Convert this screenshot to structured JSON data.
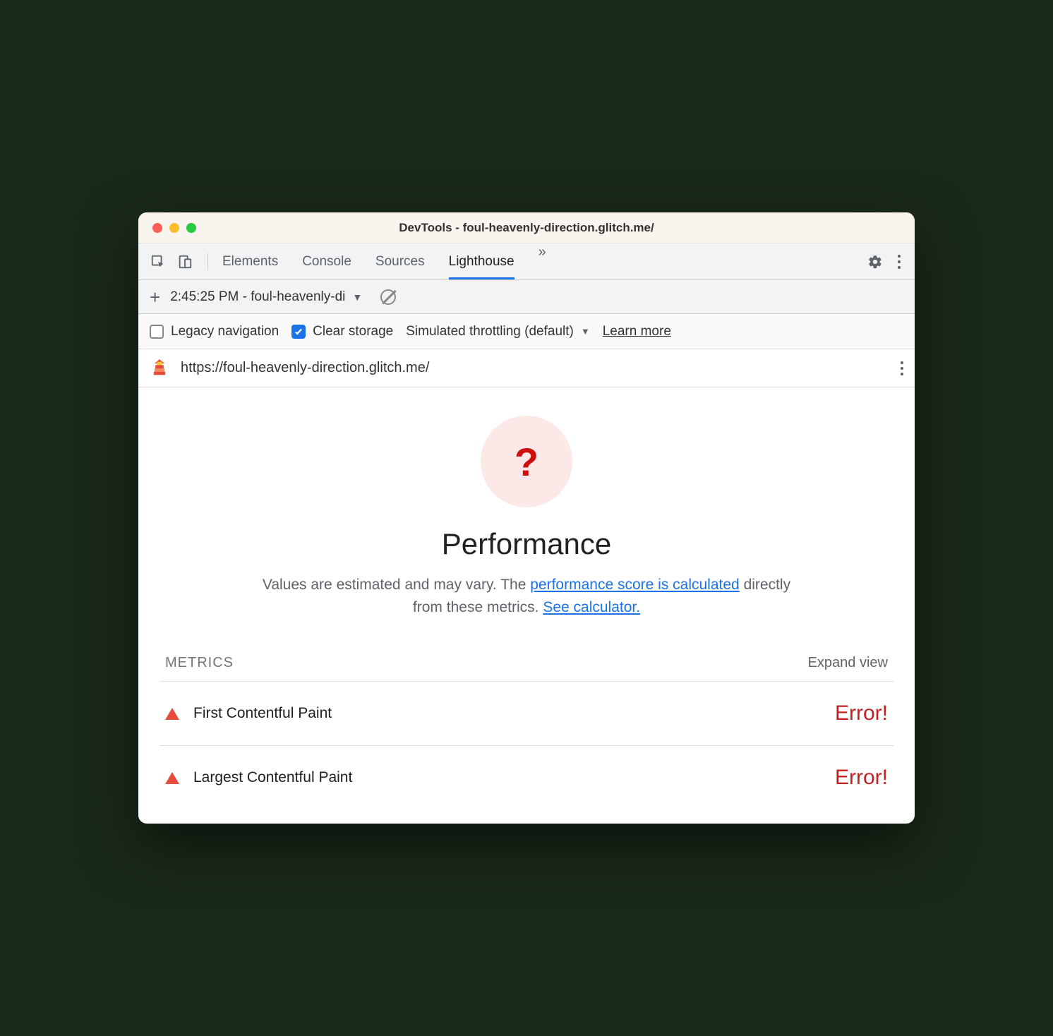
{
  "window": {
    "title": "DevTools - foul-heavenly-direction.glitch.me/"
  },
  "tabs": {
    "items": [
      "Elements",
      "Console",
      "Sources",
      "Lighthouse"
    ],
    "active": "Lighthouse"
  },
  "report_select": "2:45:25 PM - foul-heavenly-di",
  "options": {
    "legacy_nav": {
      "label": "Legacy navigation",
      "checked": false
    },
    "clear_storage": {
      "label": "Clear storage",
      "checked": true
    },
    "throttling": "Simulated throttling (default)",
    "learn_more": "Learn more"
  },
  "url": "https://foul-heavenly-direction.glitch.me/",
  "gauge_symbol": "?",
  "category_title": "Performance",
  "description": {
    "part1": "Values are estimated and may vary. The ",
    "link1": "performance score is calculated",
    "part2": " directly from these metrics. ",
    "link2": "See calculator."
  },
  "metrics_section": {
    "title": "METRICS",
    "expand": "Expand view",
    "items": [
      {
        "name": "First Contentful Paint",
        "value": "Error!"
      },
      {
        "name": "Largest Contentful Paint",
        "value": "Error!"
      }
    ]
  }
}
